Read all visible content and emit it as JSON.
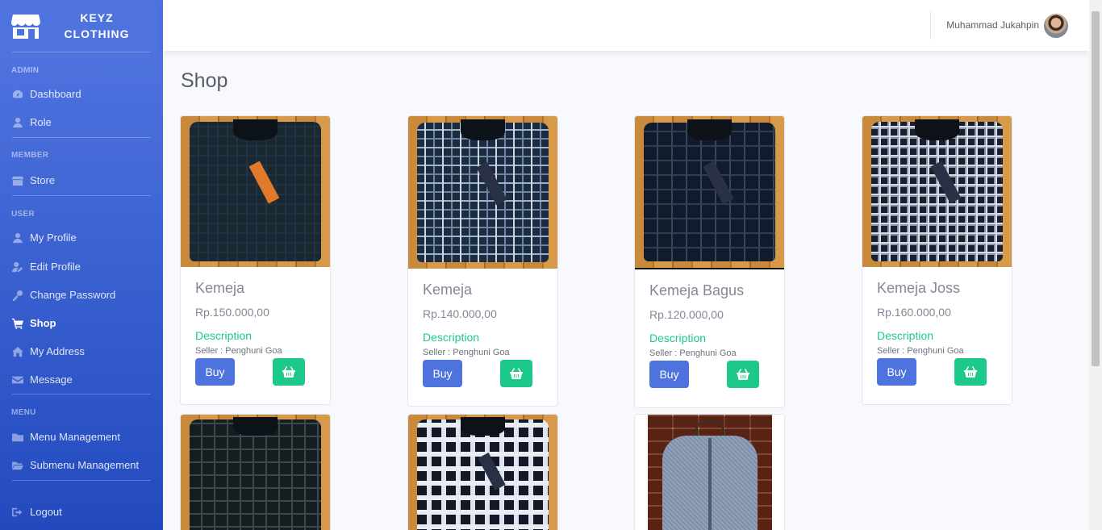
{
  "brand": {
    "line1": "KEYZ",
    "line2": "CLOTHING",
    "icon": "store-icon"
  },
  "sidebar": {
    "sections": [
      {
        "heading": "ADMIN",
        "items": [
          {
            "label": "Dashboard",
            "icon": "tachometer-icon"
          },
          {
            "label": "Role",
            "icon": "user-icon"
          }
        ]
      },
      {
        "heading": "MEMBER",
        "items": [
          {
            "label": "Store",
            "icon": "store-icon"
          }
        ]
      },
      {
        "heading": "USER",
        "items": [
          {
            "label": "My Profile",
            "icon": "user-icon"
          },
          {
            "label": "Edit Profile",
            "icon": "user-edit-icon"
          },
          {
            "label": "Change Password",
            "icon": "key-icon"
          },
          {
            "label": "Shop",
            "icon": "shopping-cart-icon",
            "active": true
          },
          {
            "label": "My Address",
            "icon": "home-icon"
          },
          {
            "label": "Message",
            "icon": "envelope-icon"
          }
        ]
      },
      {
        "heading": "MENU",
        "items": [
          {
            "label": "Menu Management",
            "icon": "folder-icon"
          },
          {
            "label": "Submenu Management",
            "icon": "folder-open-icon"
          }
        ]
      }
    ],
    "logout": {
      "label": "Logout",
      "icon": "sign-out-icon"
    }
  },
  "topbar": {
    "user_name": "Muhammad Jukahpin"
  },
  "page": {
    "title": "Shop"
  },
  "products": [
    {
      "name": "Kemeja",
      "price": "Rp.150.000,00",
      "description": "Description",
      "seller": "Seller : Penghuni Goa",
      "buy": "Buy",
      "cart_icon": "shopping-basket-icon"
    },
    {
      "name": "Kemeja",
      "price": "Rp.140.000,00",
      "description": "Description",
      "seller": "Seller : Penghuni Goa",
      "buy": "Buy",
      "cart_icon": "shopping-basket-icon"
    },
    {
      "name": "Kemeja Bagus",
      "price": "Rp.120.000,00",
      "description": "Description",
      "seller": "Seller : Penghuni Goa",
      "buy": "Buy",
      "cart_icon": "shopping-basket-icon"
    },
    {
      "name": "Kemeja Joss",
      "price": "Rp.160.000,00",
      "description": "Description",
      "seller": "Seller : Penghuni Goa",
      "buy": "Buy",
      "cart_icon": "shopping-basket-icon"
    }
  ],
  "colors": {
    "primary": "#4e73df",
    "success": "#1cc88a",
    "text_muted": "#858796"
  }
}
